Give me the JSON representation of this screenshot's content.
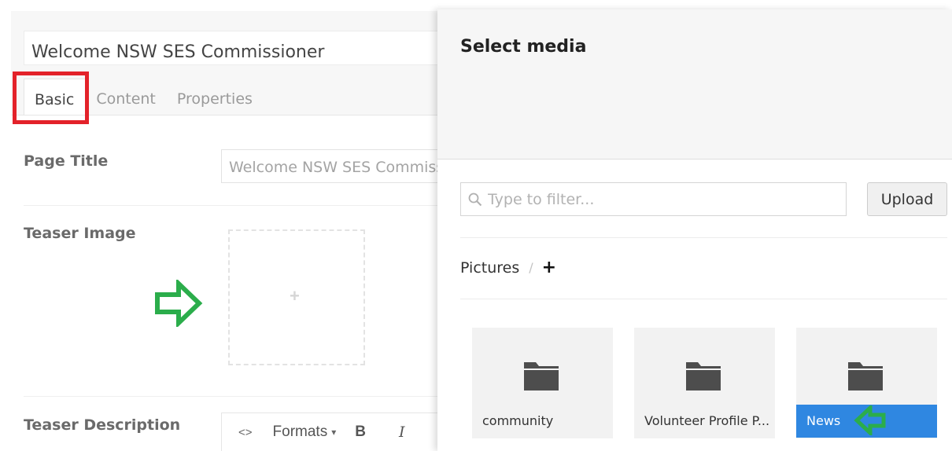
{
  "editor": {
    "node_name": "Welcome NSW SES Commissioner",
    "tabs": [
      {
        "label": "Basic",
        "active": true
      },
      {
        "label": "Content",
        "active": false
      },
      {
        "label": "Properties",
        "active": false
      }
    ],
    "page_title_label": "Page Title",
    "page_title_value": "Welcome NSW SES Commissioner",
    "teaser_image_label": "Teaser Image",
    "teaser_image_add": "+",
    "teaser_description_label": "Teaser Description",
    "rte_toolbar": {
      "source_code": "<>",
      "formats": "Formats",
      "formats_caret": "▾",
      "bold": "B",
      "italic": "I"
    }
  },
  "media_picker": {
    "title": "Select media",
    "filter_placeholder": "Type to filter...",
    "upload_label": "Upload",
    "breadcrumb": {
      "root": "Pictures",
      "separator": "/",
      "add": "+"
    },
    "folders": [
      {
        "name": "community",
        "selected": false
      },
      {
        "name": "Volunteer Profile P...",
        "selected": false
      },
      {
        "name": "News",
        "selected": true
      }
    ]
  },
  "colors": {
    "selected_blue": "#2f87e1",
    "annotation_red": "#e3222a",
    "annotation_green": "#2bad4b"
  }
}
